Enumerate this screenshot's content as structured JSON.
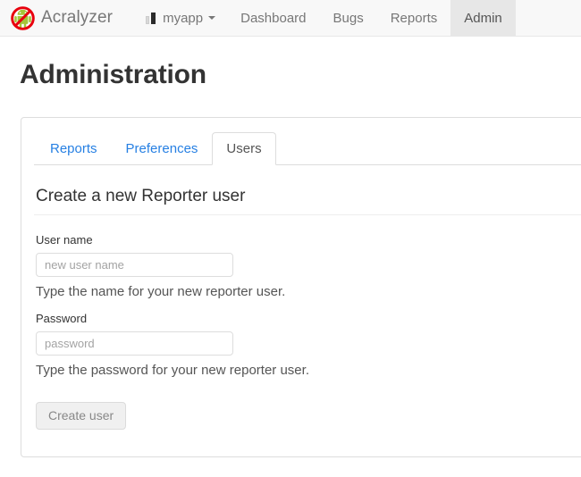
{
  "navbar": {
    "brand": {
      "label": "Acralyzer",
      "logo_icon": "android-prohibited-icon"
    },
    "app_selector": {
      "icon": "bar-chart-icon",
      "label": "myapp",
      "caret_icon": "caret-down-icon"
    },
    "links": [
      {
        "label": "Dashboard",
        "active": false
      },
      {
        "label": "Bugs",
        "active": false
      },
      {
        "label": "Reports",
        "active": false
      },
      {
        "label": "Admin",
        "active": true
      }
    ],
    "background_color": "#f8f8f8",
    "active_tab_color": "#e7e7e7"
  },
  "page": {
    "title": "Administration"
  },
  "tabs": [
    {
      "label": "Reports",
      "active": false
    },
    {
      "label": "Preferences",
      "active": false
    },
    {
      "label": "Users",
      "active": true
    }
  ],
  "panel": {
    "section_title": "Create a new Reporter user",
    "fields": [
      {
        "label": "User name",
        "value": "",
        "placeholder": "new user name",
        "help": "Type the name for your new reporter user."
      },
      {
        "label": "Password",
        "value": "",
        "placeholder": "password",
        "help": "Type the password for your new reporter user."
      }
    ],
    "submit_label": "Create user"
  },
  "colors": {
    "link": "#2780e3",
    "text": "#333333",
    "muted": "#777777",
    "border": "#dddddd"
  }
}
